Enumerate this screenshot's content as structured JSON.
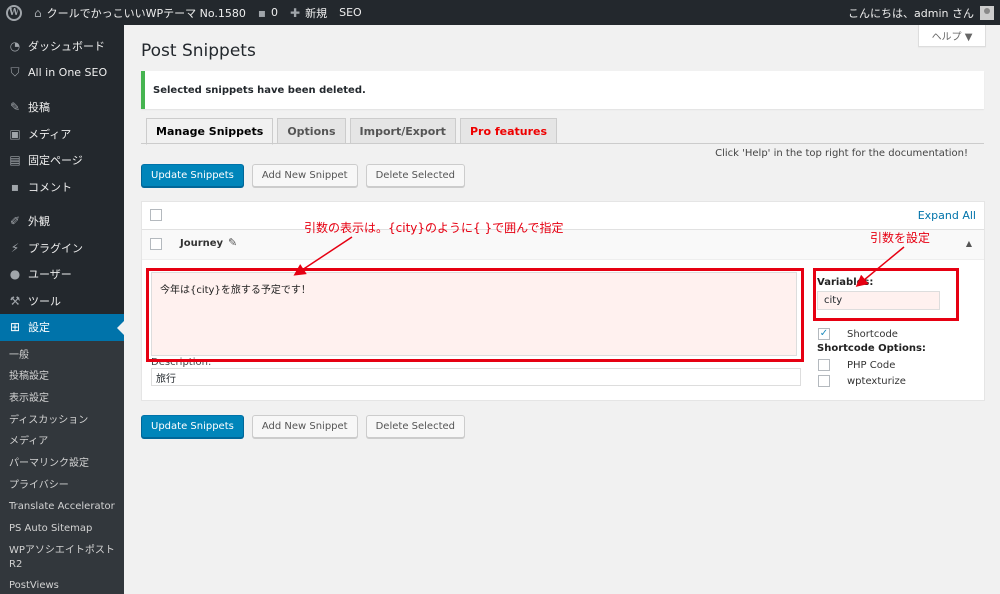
{
  "adminbar": {
    "site_name": "クールでかっこいいWPテーマ No.1580",
    "comments_count": "0",
    "new_label": "新規",
    "seo_label": "SEO",
    "greeting": "こんにちは、admin さん"
  },
  "sidebar": {
    "items": [
      {
        "label": "ダッシュボード",
        "icon": "dashboard-icon"
      },
      {
        "label": "All in One SEO",
        "icon": "shield-icon"
      },
      {
        "label": "投稿",
        "icon": "pin-icon"
      },
      {
        "label": "メディア",
        "icon": "media-icon"
      },
      {
        "label": "固定ページ",
        "icon": "page-icon"
      },
      {
        "label": "コメント",
        "icon": "comment-icon"
      },
      {
        "label": "外観",
        "icon": "brush-icon"
      },
      {
        "label": "プラグイン",
        "icon": "plugin-icon"
      },
      {
        "label": "ユーザー",
        "icon": "user-icon"
      },
      {
        "label": "ツール",
        "icon": "wrench-icon"
      },
      {
        "label": "設定",
        "icon": "settings-icon"
      }
    ],
    "submenu": [
      "一般",
      "投稿設定",
      "表示設定",
      "ディスカッション",
      "メディア",
      "パーマリンク設定",
      "プライバシー",
      "Translate Accelerator",
      "PS Auto Sitemap",
      "WPアソシエイトポスト R2",
      "PostViews"
    ]
  },
  "main": {
    "help_tab": "ヘルプ ▼",
    "title": "Post Snippets",
    "notice": "Selected snippets have been deleted.",
    "tabs": [
      {
        "label": "Manage Snippets"
      },
      {
        "label": "Options"
      },
      {
        "label": "Import/Export"
      },
      {
        "label": "Pro features"
      }
    ],
    "help_note": "Click 'Help' in the top right for the documentation!",
    "buttons": {
      "update": "Update Snippets",
      "add": "Add New Snippet",
      "delete": "Delete Selected"
    },
    "expand_all": "Expand All",
    "snippet": {
      "name": "Journey",
      "code": "今年は{city}を旅する予定です！",
      "description_label": "Description:",
      "description": "旅行",
      "variables_label": "Variables:",
      "variables": "city",
      "shortcode_label": "Shortcode",
      "shortcode_options_label": "Shortcode Options:",
      "php_code_label": "PHP Code",
      "wptexturize_label": "wptexturize"
    }
  },
  "annotations": {
    "args_note": "引数の表示は。{city}のように{ }で囲んで指定",
    "vars_note": "引数を設定",
    "color": "#e60012"
  }
}
